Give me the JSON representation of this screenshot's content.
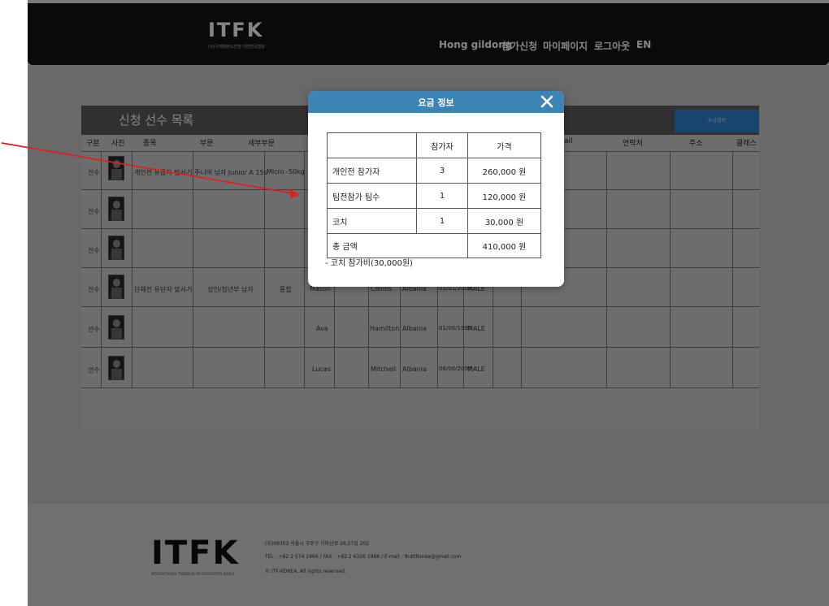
{
  "header": {
    "logo_text": "ITFK",
    "logo_subtext": "(사)국제태권도연맹 대한민국협회",
    "nav": [
      "Hong gildong",
      "참가신청",
      "마이페이지",
      "로그아웃",
      "EN"
    ]
  },
  "panel": {
    "title": "신청 선수 목록",
    "fee_button": "요금정보",
    "columns_left": [
      "구분",
      "사진",
      "종목",
      "부문",
      "세부부문"
    ],
    "columns_right": [
      "ail",
      "연락처",
      "주소",
      "클래스"
    ],
    "rows": [
      {
        "type": "선수",
        "event": "개인전 유급자 맞서기",
        "division": "주니어 남자 Junior A 15s",
        "sub": "Micro -50kg",
        "first": "",
        "last": "",
        "country": "",
        "dob": "",
        "gender": ""
      },
      {
        "type": "선수",
        "event": "",
        "division": "",
        "sub": "",
        "first": "",
        "last": "",
        "country": "",
        "dob": "",
        "gender": ""
      },
      {
        "type": "선수",
        "event": "",
        "division": "",
        "sub": "",
        "first": "",
        "last": "",
        "country": "",
        "dob": "",
        "gender": ""
      },
      {
        "type": "선수",
        "event": "단체전 유단자 맞서기",
        "division": "성인/청년부 남자",
        "sub": "통합",
        "first": "Mason",
        "last": "Collins",
        "country": "Albania",
        "dob": "01/01/2007",
        "gender": "MALE"
      },
      {
        "type": "선수",
        "event": "",
        "division": "",
        "sub": "",
        "first": "Ava",
        "last": "Hamilton",
        "country": "Albania",
        "dob": "01/06/1985",
        "gender": "MALE"
      },
      {
        "type": "선수",
        "event": "",
        "division": "",
        "sub": "",
        "first": "Lucas",
        "last": "Mitchell",
        "country": "Albania",
        "dob": "06/06/2007",
        "gender": "MALE"
      }
    ]
  },
  "modal": {
    "title": "요금 정보",
    "table_headers": [
      "",
      "참가자",
      "가격"
    ],
    "rows": [
      {
        "label": "개인전 참가자",
        "count": "3",
        "price": "260,000 원"
      },
      {
        "label": "팀전참가 팀수",
        "count": "1",
        "price": "120,000 원"
      },
      {
        "label": "코치",
        "count": "1",
        "price": "30,000 원"
      }
    ],
    "total_label": "총 금액",
    "total_price": "410,000 원",
    "note": "- 코치 참가비(30,000원)"
  },
  "footer": {
    "logo_text": "ITFK",
    "logo_subtext": "INTERNATIONAL TAEKWON-DO FEDERATION KOREA",
    "address": "(우)08303 서울시 구로구 가마산로 26,27길 202",
    "contact": "TEL : +82 2 574 1966 / FAX : +82 2 6326 1968 / E-mail : tkditfkorea@gmail.com",
    "copyright": "© ITF-KOREA. All rights reserved."
  },
  "colors": {
    "modal_header": "#3d84b6",
    "topbar": "#141414",
    "annotation_arrow": "#e01e1e",
    "fee_button": "#2f86d6"
  }
}
